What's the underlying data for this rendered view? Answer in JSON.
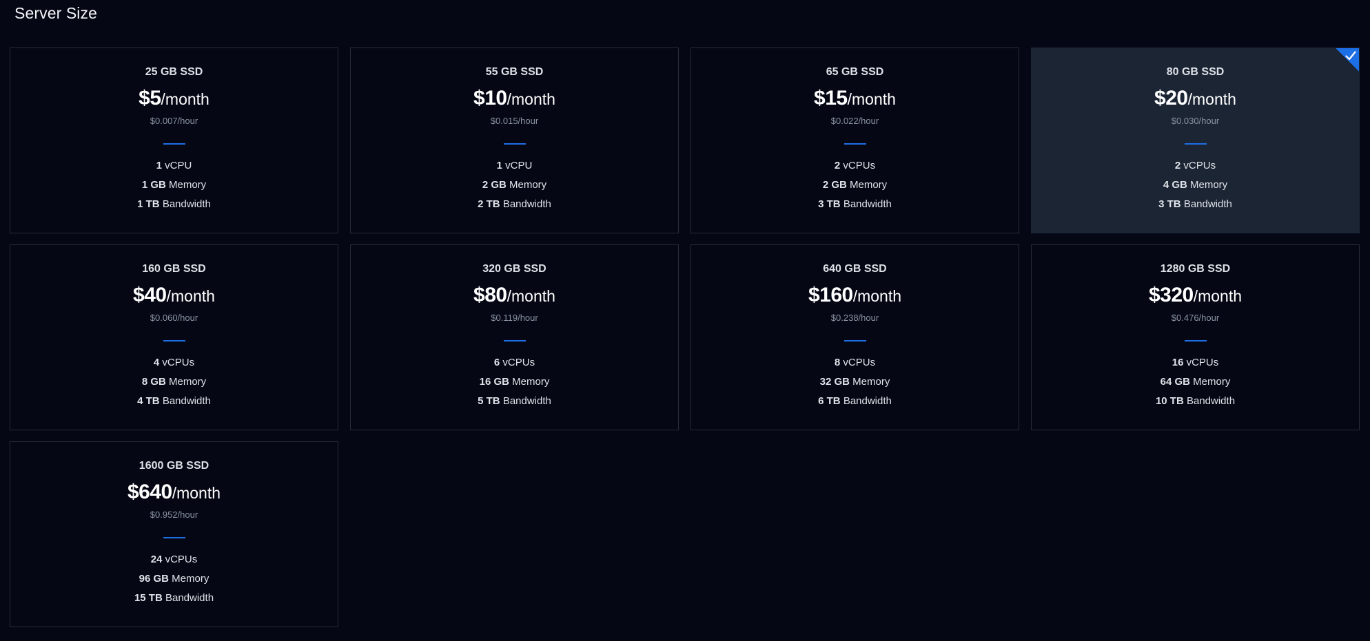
{
  "page": {
    "title": "Server Size"
  },
  "plans": [
    {
      "storage": "25 GB SSD",
      "price": "$5",
      "period": "/month",
      "hourly": "$0.007/hour",
      "cpu_value": "1",
      "cpu_unit": "vCPU",
      "mem_value": "1 GB",
      "mem_unit": "Memory",
      "bw_value": "1 TB",
      "bw_unit": "Bandwidth",
      "selected": false
    },
    {
      "storage": "55 GB SSD",
      "price": "$10",
      "period": "/month",
      "hourly": "$0.015/hour",
      "cpu_value": "1",
      "cpu_unit": "vCPU",
      "mem_value": "2 GB",
      "mem_unit": "Memory",
      "bw_value": "2 TB",
      "bw_unit": "Bandwidth",
      "selected": false
    },
    {
      "storage": "65 GB SSD",
      "price": "$15",
      "period": "/month",
      "hourly": "$0.022/hour",
      "cpu_value": "2",
      "cpu_unit": "vCPUs",
      "mem_value": "2 GB",
      "mem_unit": "Memory",
      "bw_value": "3 TB",
      "bw_unit": "Bandwidth",
      "selected": false
    },
    {
      "storage": "80 GB SSD",
      "price": "$20",
      "period": "/month",
      "hourly": "$0.030/hour",
      "cpu_value": "2",
      "cpu_unit": "vCPUs",
      "mem_value": "4 GB",
      "mem_unit": "Memory",
      "bw_value": "3 TB",
      "bw_unit": "Bandwidth",
      "selected": true
    },
    {
      "storage": "160 GB SSD",
      "price": "$40",
      "period": "/month",
      "hourly": "$0.060/hour",
      "cpu_value": "4",
      "cpu_unit": "vCPUs",
      "mem_value": "8 GB",
      "mem_unit": "Memory",
      "bw_value": "4 TB",
      "bw_unit": "Bandwidth",
      "selected": false
    },
    {
      "storage": "320 GB SSD",
      "price": "$80",
      "period": "/month",
      "hourly": "$0.119/hour",
      "cpu_value": "6",
      "cpu_unit": "vCPUs",
      "mem_value": "16 GB",
      "mem_unit": "Memory",
      "bw_value": "5 TB",
      "bw_unit": "Bandwidth",
      "selected": false
    },
    {
      "storage": "640 GB SSD",
      "price": "$160",
      "period": "/month",
      "hourly": "$0.238/hour",
      "cpu_value": "8",
      "cpu_unit": "vCPUs",
      "mem_value": "32 GB",
      "mem_unit": "Memory",
      "bw_value": "6 TB",
      "bw_unit": "Bandwidth",
      "selected": false
    },
    {
      "storage": "1280 GB SSD",
      "price": "$320",
      "period": "/month",
      "hourly": "$0.476/hour",
      "cpu_value": "16",
      "cpu_unit": "vCPUs",
      "mem_value": "64 GB",
      "mem_unit": "Memory",
      "bw_value": "10 TB",
      "bw_unit": "Bandwidth",
      "selected": false
    },
    {
      "storage": "1600 GB SSD",
      "price": "$640",
      "period": "/month",
      "hourly": "$0.952/hour",
      "cpu_value": "24",
      "cpu_unit": "vCPUs",
      "mem_value": "96 GB",
      "mem_unit": "Memory",
      "bw_value": "15 TB",
      "bw_unit": "Bandwidth",
      "selected": false
    }
  ],
  "icons": {
    "selected_marker": "checkmark-icon"
  },
  "colors": {
    "background": "#050814",
    "card_border": "#262c38",
    "selected_background": "#1c2534",
    "accent": "#1f6ee5"
  }
}
